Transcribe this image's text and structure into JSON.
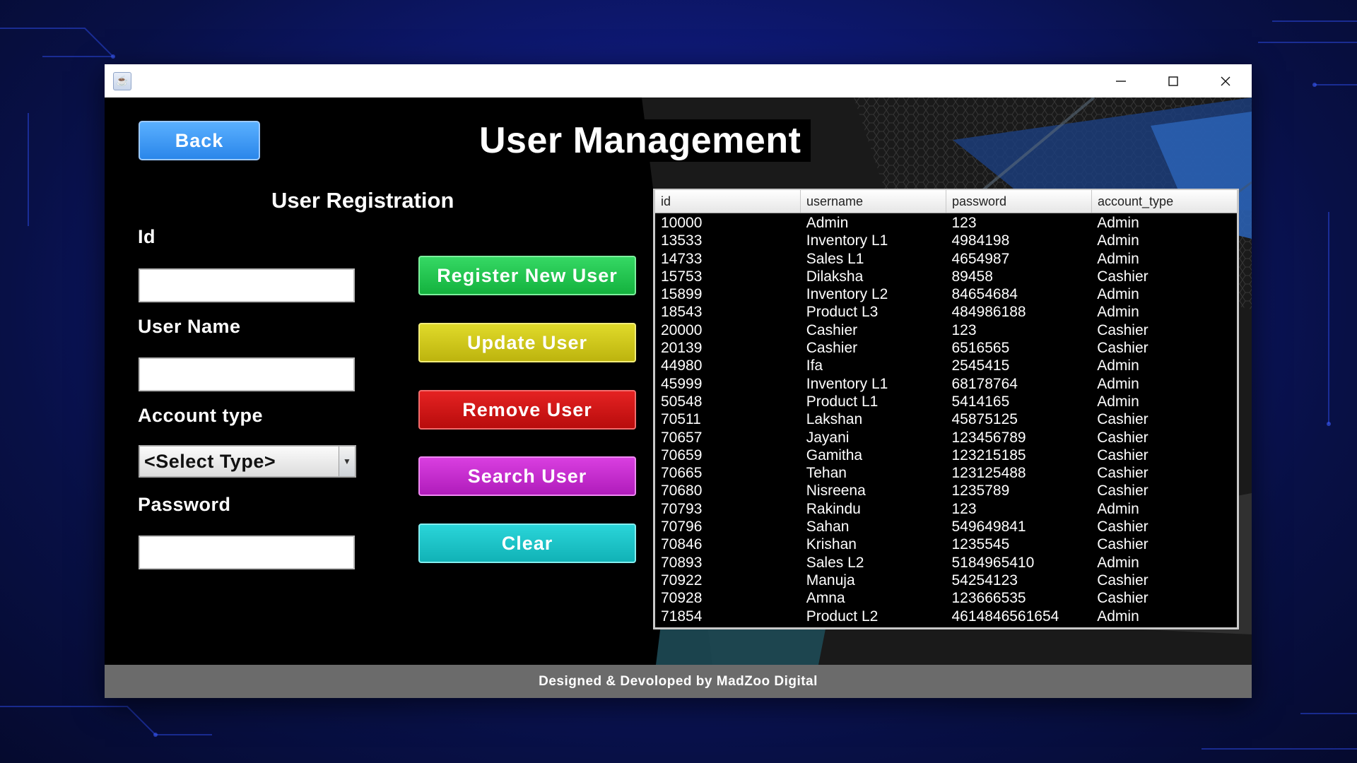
{
  "window": {
    "app_icon": "java-icon",
    "controls": [
      "minimize-icon",
      "maximize-icon",
      "close-icon"
    ]
  },
  "header": {
    "back_label": "Back",
    "title": "User Management"
  },
  "registration": {
    "title": "User Registration",
    "id_label": "Id",
    "id_value": "",
    "username_label": "User Name",
    "username_value": "",
    "account_type_label": "Account type",
    "account_type_value": "<Select Type>",
    "password_label": "Password",
    "password_value": ""
  },
  "actions": {
    "register": "Register New User",
    "update": "Update User",
    "remove": "Remove User",
    "search": "Search User",
    "clear": "Clear"
  },
  "table": {
    "columns": [
      "id",
      "username",
      "password",
      "account_type"
    ],
    "rows": [
      [
        "10000",
        "Admin",
        "123",
        "Admin"
      ],
      [
        "13533",
        "Inventory L1",
        "4984198",
        "Admin"
      ],
      [
        "14733",
        "Sales L1",
        "4654987",
        "Admin"
      ],
      [
        "15753",
        "Dilaksha",
        "89458",
        "Cashier"
      ],
      [
        "15899",
        "Inventory L2",
        "84654684",
        "Admin"
      ],
      [
        "18543",
        "Product L3",
        "484986188",
        "Admin"
      ],
      [
        "20000",
        "Cashier",
        "123",
        "Cashier"
      ],
      [
        "20139",
        "Cashier",
        "6516565",
        "Cashier"
      ],
      [
        "44980",
        "Ifa",
        "2545415",
        "Admin"
      ],
      [
        "45999",
        "Inventory L1",
        "68178764",
        "Admin"
      ],
      [
        "50548",
        "Product L1",
        "5414165",
        "Admin"
      ],
      [
        "70511",
        "Lakshan",
        "45875125",
        "Cashier"
      ],
      [
        "70657",
        "Jayani",
        "123456789",
        "Cashier"
      ],
      [
        "70659",
        "Gamitha",
        "123215185",
        "Cashier"
      ],
      [
        "70665",
        "Tehan",
        "123125488",
        "Cashier"
      ],
      [
        "70680",
        "Nisreena",
        "1235789",
        "Cashier"
      ],
      [
        "70793",
        "Rakindu",
        "123",
        "Admin"
      ],
      [
        "70796",
        "Sahan",
        "549649841",
        "Cashier"
      ],
      [
        "70846",
        "Krishan",
        "1235545",
        "Cashier"
      ],
      [
        "70893",
        "Sales L2",
        "5184965410",
        "Admin"
      ],
      [
        "70922",
        "Manuja",
        "54254123",
        "Cashier"
      ],
      [
        "70928",
        "Amna",
        "123666535",
        "Cashier"
      ],
      [
        "71854",
        "Product L2",
        "4614846561654",
        "Admin"
      ]
    ]
  },
  "footer": {
    "text": "Designed & Devoloped by MadZoo Digital"
  },
  "colors": {
    "register": "#14b23e",
    "update": "#bdb40e",
    "remove": "#b80c0c",
    "search": "#b01cbb",
    "clear": "#11b2b6",
    "back": "#2a86ea"
  }
}
